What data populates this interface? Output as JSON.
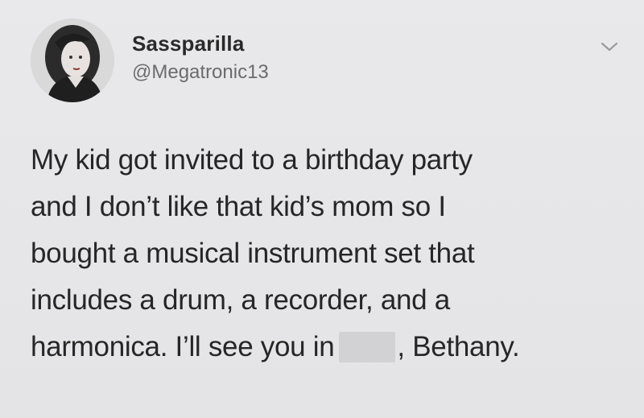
{
  "tweet": {
    "display_name": "Sassparilla",
    "handle": "@Megatronic13",
    "menu_icon": "chevron-down-icon",
    "avatar_icon": "profile-photo",
    "lines": [
      "My kid got invited to a birthday party",
      "and I don’t like that kid’s mom so I",
      "bought a musical instrument set that",
      "includes a drum, a recorder, and a"
    ],
    "last_line_before": "harmonica. I’ll see you in",
    "last_line_after": ", Bethany."
  }
}
